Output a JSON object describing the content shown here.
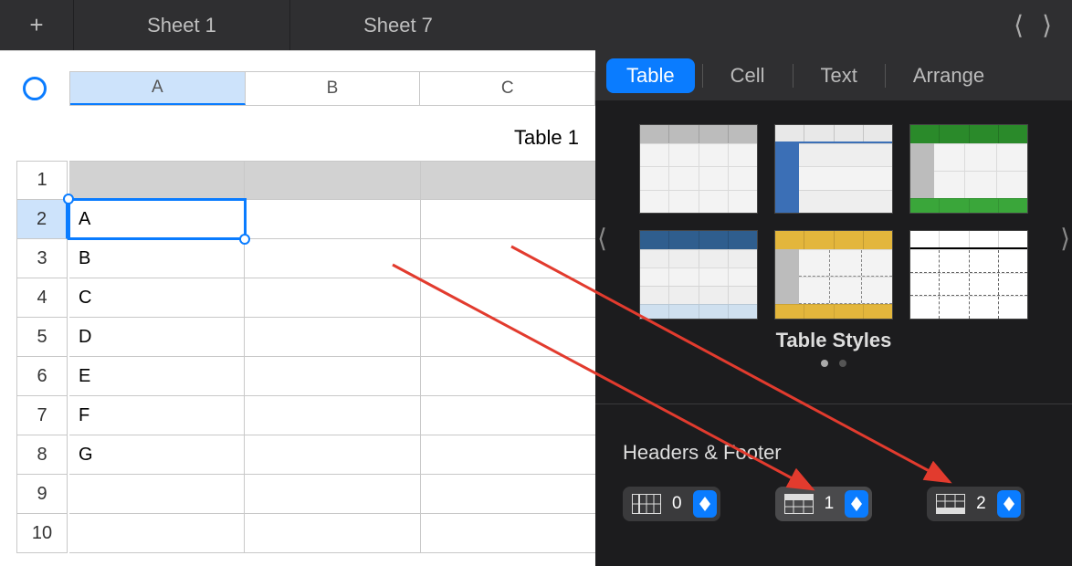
{
  "tabs": {
    "sheet1": "Sheet 1",
    "sheet7": "Sheet 7"
  },
  "table": {
    "title": "Table 1",
    "columns": [
      "A",
      "B",
      "C"
    ],
    "rows": [
      "1",
      "2",
      "3",
      "4",
      "5",
      "6",
      "7",
      "8",
      "9",
      "10"
    ],
    "data": [
      "A",
      "B",
      "C",
      "D",
      "E",
      "F",
      "G"
    ]
  },
  "inspector": {
    "tabs": {
      "table": "Table",
      "cell": "Cell",
      "text": "Text",
      "arrange": "Arrange"
    },
    "styles_title": "Table Styles",
    "hf_title": "Headers & Footer",
    "hf": {
      "cols": "0",
      "head_rows": "1",
      "foot_rows": "2"
    }
  }
}
